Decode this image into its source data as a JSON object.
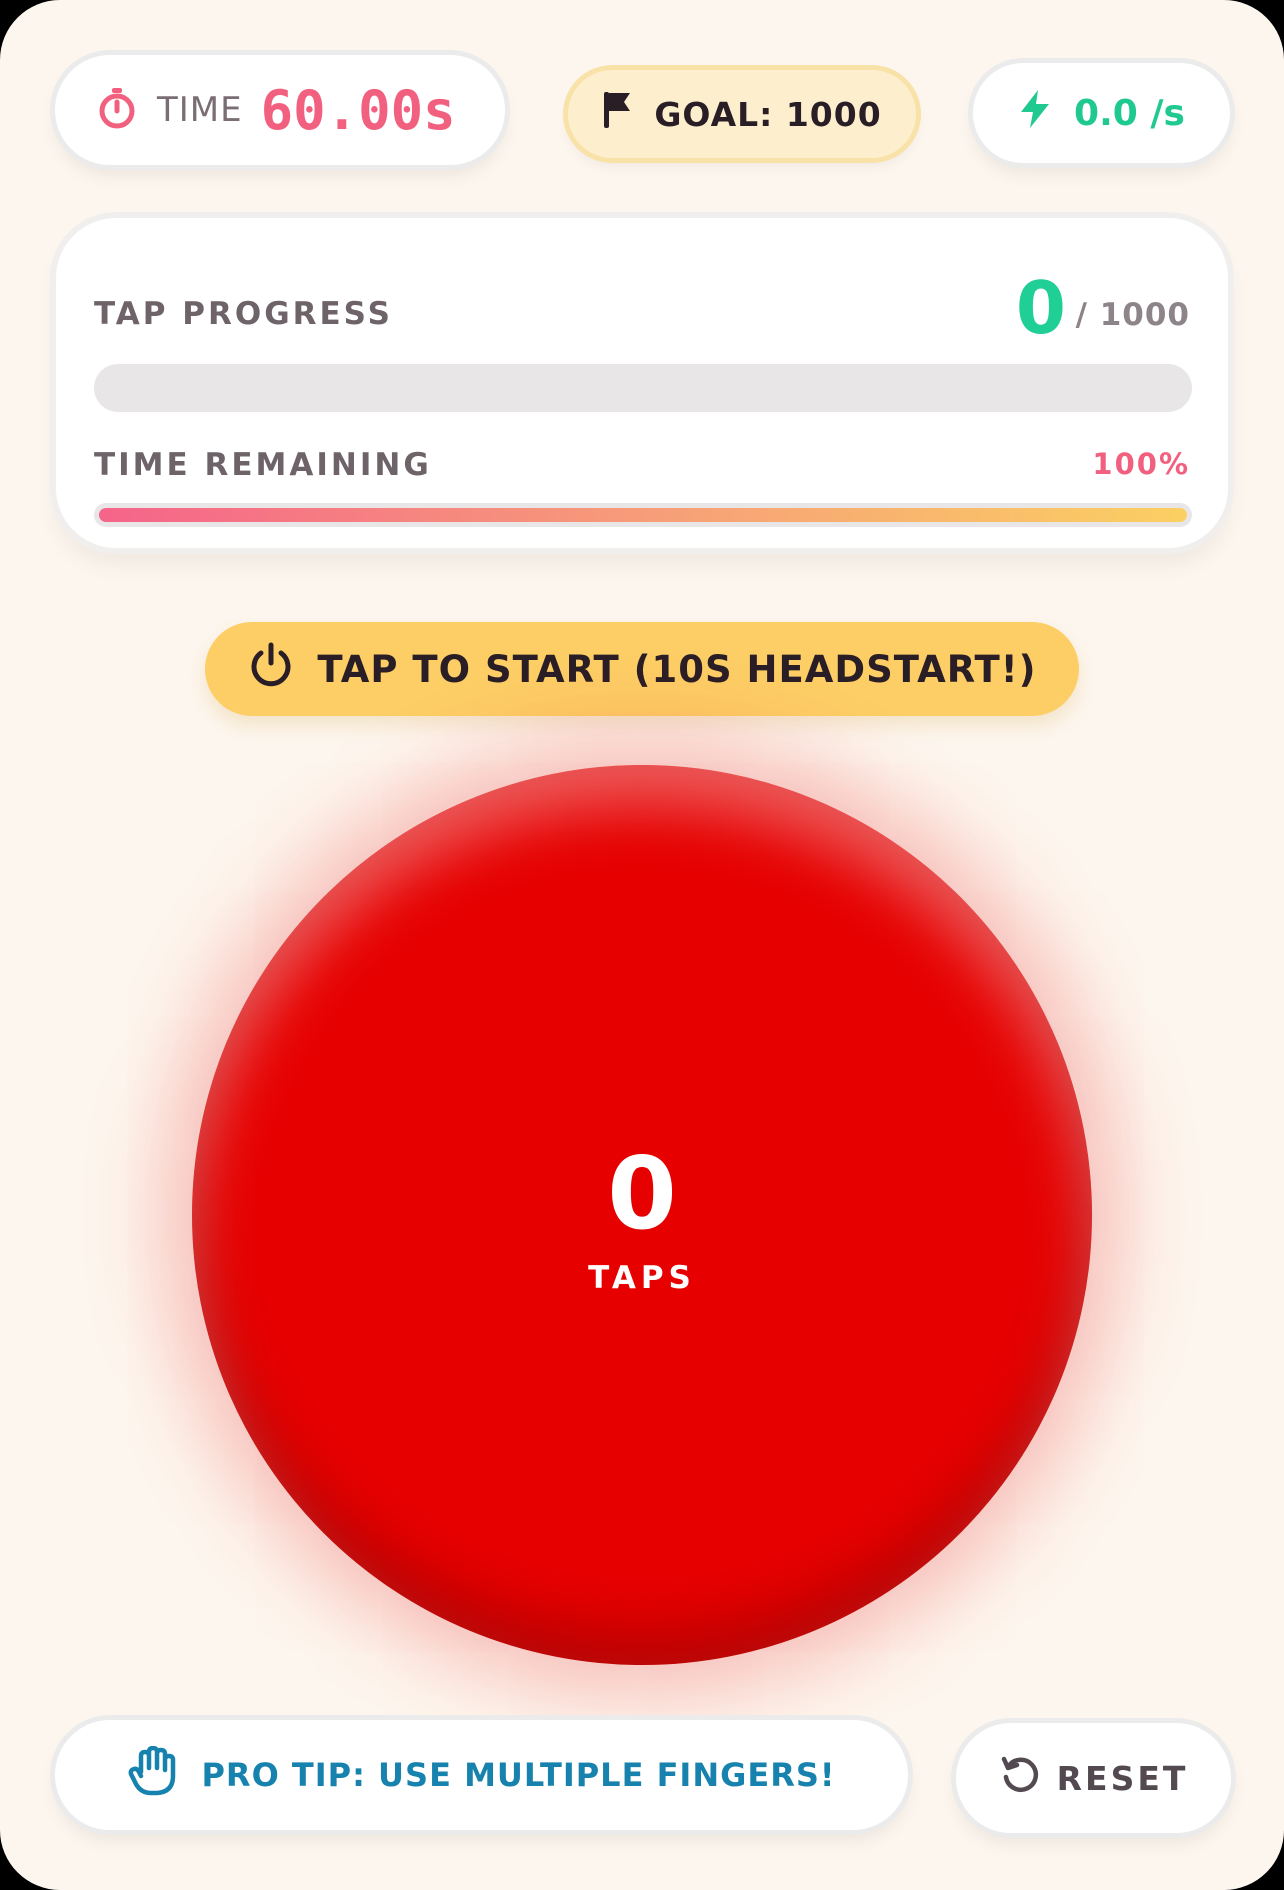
{
  "header": {
    "time_label": "TIME",
    "time_value": "60.00s",
    "goal_label": "GOAL: 1000",
    "rate_label": "0.0 /s"
  },
  "progress_card": {
    "tap_progress_label": "TAP PROGRESS",
    "tap_count": "0",
    "tap_goal": "/ 1000",
    "tap_progress_fraction": 0,
    "time_remaining_label": "TIME REMAINING",
    "time_remaining_percent": "100%",
    "time_remaining_fraction": 1
  },
  "start_button": {
    "label": "TAP TO START (10S HEADSTART!)"
  },
  "tap_button": {
    "count": "0",
    "label": "TAPS",
    "color": "#e60000"
  },
  "footer": {
    "tip_label": "PRO TIP: USE MULTIPLE FINGERS!",
    "reset_label": "RESET"
  },
  "colors": {
    "background": "#fdf6ee",
    "accent_pink": "#f2607f",
    "accent_green": "#1fcf95",
    "accent_yellow": "#fdce66",
    "tip_blue": "#1682ad"
  },
  "icons": {
    "time": "stopwatch-icon",
    "goal": "flag-icon",
    "rate": "lightning-icon",
    "start": "power-icon",
    "tip": "hand-icon",
    "reset": "reset-icon"
  }
}
